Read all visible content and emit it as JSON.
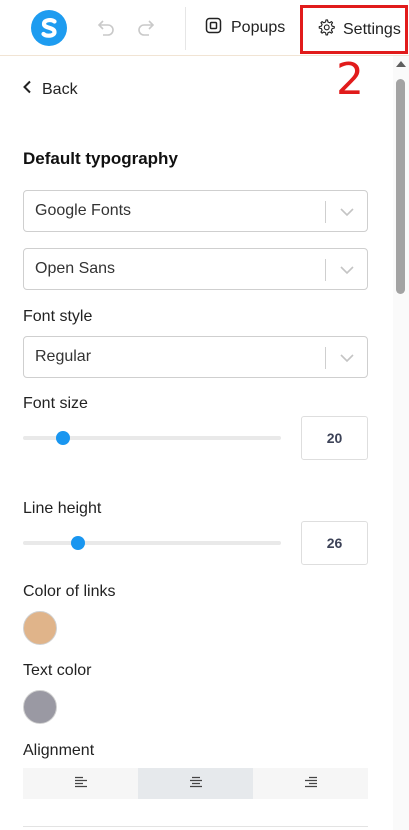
{
  "toolbar": {
    "popups_label": "Popups",
    "settings_label": "Settings"
  },
  "annotation": {
    "step": "2",
    "color": "#e11b1b"
  },
  "brand": {
    "accent": "#1e9cf0"
  },
  "panel": {
    "back_label": "Back",
    "section_title": "Default typography",
    "font_source": {
      "value": "Google Fonts"
    },
    "font_family": {
      "value": "Open Sans"
    },
    "font_style": {
      "label": "Font style",
      "value": "Regular"
    },
    "font_size": {
      "label": "Font size",
      "value": "20",
      "slider_fraction": 0.155
    },
    "line_height": {
      "label": "Line height",
      "value": "26",
      "slider_fraction": 0.215
    },
    "link_color": {
      "label": "Color of links",
      "color": "#e0b48a"
    },
    "text_color": {
      "label": "Text color",
      "color": "#9a99a3"
    },
    "alignment": {
      "label": "Alignment",
      "options": [
        "left",
        "center",
        "right"
      ],
      "selected": "center"
    }
  }
}
